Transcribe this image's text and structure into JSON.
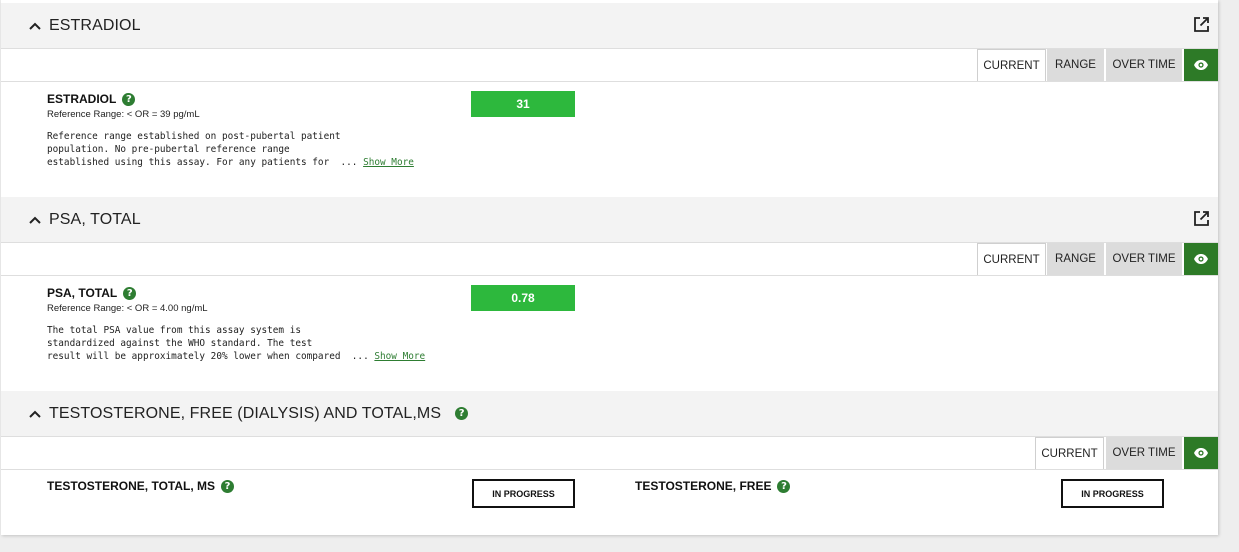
{
  "sections": [
    {
      "title": "ESTRADIOL",
      "tabs": [
        "CURRENT",
        "RANGE",
        "OVER TIME"
      ],
      "active_tab": "CURRENT",
      "test": {
        "name": "ESTRADIOL",
        "reference_range": "Reference Range: < OR = 39 pg/mL",
        "value": "31",
        "note_lines": [
          "Reference range established on post-pubertal patient",
          "population. No pre-pubertal reference range",
          "established using this assay. For any patients for  ... "
        ],
        "show_more": "Show More"
      }
    },
    {
      "title": "PSA, TOTAL",
      "tabs": [
        "CURRENT",
        "RANGE",
        "OVER TIME"
      ],
      "active_tab": "CURRENT",
      "test": {
        "name": "PSA, TOTAL",
        "reference_range": "Reference Range: < OR = 4.00 ng/mL",
        "value": "0.78",
        "note_lines": [
          "The total PSA value from this assay system is",
          "standardized against the WHO standard. The test",
          "result will be approximately 20% lower when compared  ... "
        ],
        "show_more": "Show More"
      }
    },
    {
      "title": "TESTOSTERONE, FREE (DIALYSIS) AND TOTAL,MS",
      "tabs": [
        "CURRENT",
        "OVER TIME"
      ],
      "active_tab": "CURRENT",
      "tests": [
        {
          "name": "TESTOSTERONE, TOTAL, MS",
          "status": "IN PROGRESS"
        },
        {
          "name": "TESTOSTERONE, FREE",
          "status": "IN PROGRESS"
        }
      ]
    }
  ],
  "colors": {
    "accent_green": "#2d7a27",
    "value_green": "#2db83d",
    "help_green": "#2e7d32",
    "header_bg": "#f3f3f3"
  },
  "icons": {
    "collapse": "chevron-up-icon",
    "external": "external-link-icon",
    "eye": "eye-icon",
    "help": "question-mark-icon"
  }
}
